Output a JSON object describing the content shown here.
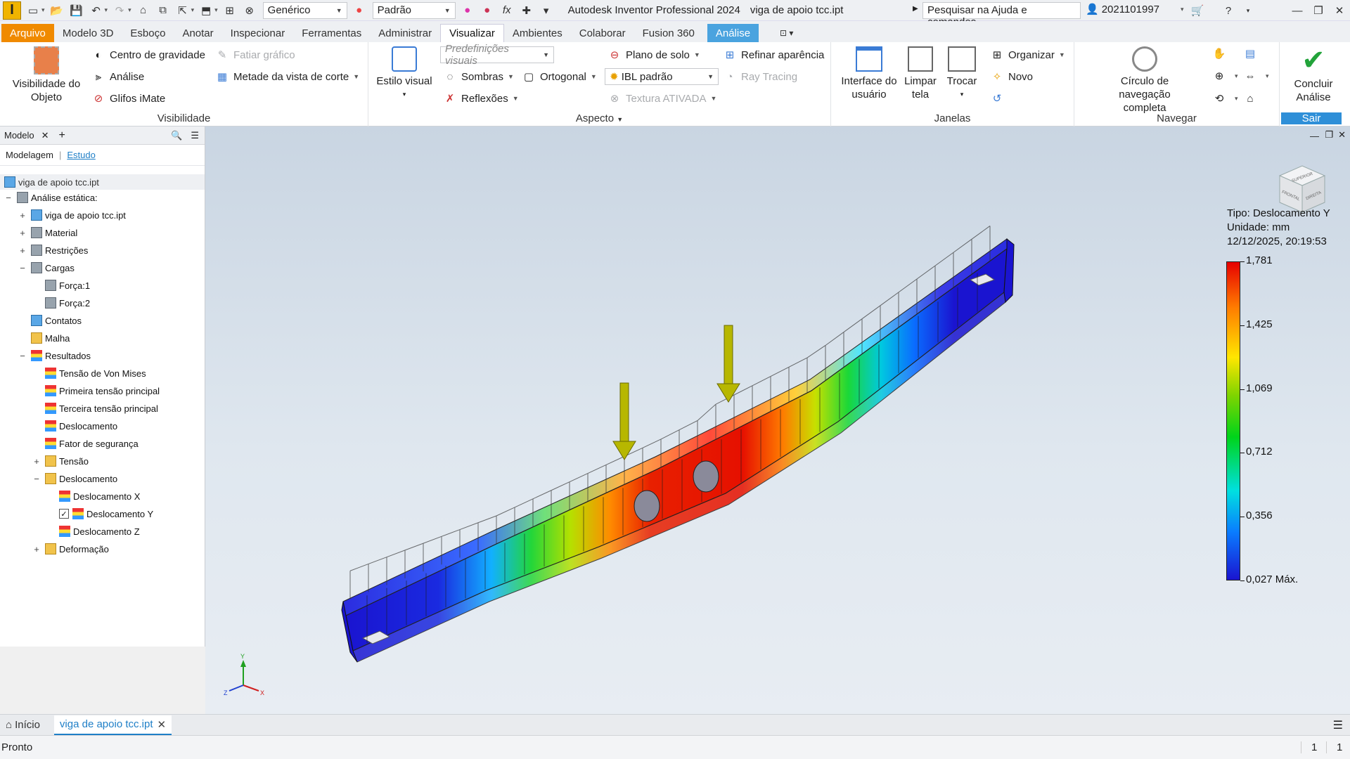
{
  "titlebar": {
    "logo": "I",
    "appearance_combo": "Genérico",
    "material_combo": "Padrão",
    "fx_symbol": "fx",
    "app_title": "Autodesk Inventor Professional 2024",
    "file_title": "viga de apoio tcc.ipt",
    "help_search": "Pesquisar na Ajuda e comandos...",
    "user": "2021101997"
  },
  "tabs": [
    "Arquivo",
    "Modelo 3D",
    "Esboço",
    "Anotar",
    "Inspecionar",
    "Ferramentas",
    "Administrar",
    "Visualizar",
    "Ambientes",
    "Colaborar",
    "Fusion 360",
    "Análise"
  ],
  "ribbon": {
    "visibilidade": {
      "label": "Visibilidade",
      "object_visibility": "Visibilidade do Objeto",
      "center_of_gravity": "Centro de gravidade",
      "analysis": "Análise",
      "imate_glyphs": "Glifos iMate",
      "slice_graphics": "Fatiar gráfico",
      "half_section": "Metade da vista de corte"
    },
    "aspecto": {
      "label": "Aspecto",
      "visual_style": "Estilo visual",
      "visual_presets": "Predefinições visuais",
      "shadows": "Sombras",
      "orthographic": "Ortogonal",
      "reflections": "Reflexões",
      "ground_plane": "Plano de solo",
      "ibl": "IBL padrão",
      "texture": "Textura ATIVADA",
      "refine_appearance": "Refinar aparência",
      "ray_tracing": "Ray Tracing"
    },
    "janelas": {
      "label": "Janelas",
      "user_interface": "Interface do usuário",
      "clean_screen": "Limpar tela",
      "switch": "Trocar",
      "arrange": "Organizar",
      "new": "Novo"
    },
    "navegar": {
      "label": "Navegar",
      "full_nav_wheel": "Círculo de navegação completa"
    },
    "sair": {
      "label": "Sair",
      "finish_analysis": "Concluir Análise"
    }
  },
  "browser": {
    "title": "Modelo",
    "tab_modeling": "Modelagem",
    "tab_study": "Estudo",
    "root": "viga de apoio tcc.ipt",
    "tree": [
      {
        "label": "Análise estática:",
        "level": 0,
        "exp": "−",
        "icon": "gen"
      },
      {
        "label": "viga de apoio tcc.ipt",
        "level": 1,
        "exp": "+",
        "icon": "part"
      },
      {
        "label": "Material",
        "level": 1,
        "exp": "+",
        "icon": "gen"
      },
      {
        "label": "Restrições",
        "level": 1,
        "exp": "+",
        "icon": "gen"
      },
      {
        "label": "Cargas",
        "level": 1,
        "exp": "−",
        "icon": "gen"
      },
      {
        "label": "Força:1",
        "level": 2,
        "exp": "",
        "icon": "gen"
      },
      {
        "label": "Força:2",
        "level": 2,
        "exp": "",
        "icon": "gen"
      },
      {
        "label": "Contatos",
        "level": 1,
        "exp": "",
        "icon": "part"
      },
      {
        "label": "Malha",
        "level": 1,
        "exp": "",
        "icon": "folder"
      },
      {
        "label": "Resultados",
        "level": 1,
        "exp": "−",
        "icon": "res"
      },
      {
        "label": "Tensão de Von Mises",
        "level": 2,
        "exp": "",
        "icon": "res"
      },
      {
        "label": "Primeira tensão principal",
        "level": 2,
        "exp": "",
        "icon": "res"
      },
      {
        "label": "Terceira tensão principal",
        "level": 2,
        "exp": "",
        "icon": "res"
      },
      {
        "label": "Deslocamento",
        "level": 2,
        "exp": "",
        "icon": "res"
      },
      {
        "label": "Fator de segurança",
        "level": 2,
        "exp": "",
        "icon": "res"
      },
      {
        "label": "Tensão",
        "level": 2,
        "exp": "+",
        "icon": "folder"
      },
      {
        "label": "Deslocamento",
        "level": 2,
        "exp": "−",
        "icon": "folder"
      },
      {
        "label": "Deslocamento X",
        "level": 3,
        "exp": "",
        "icon": "res"
      },
      {
        "label": "Deslocamento Y",
        "level": 3,
        "exp": "",
        "icon": "res",
        "checked": true
      },
      {
        "label": "Deslocamento Z",
        "level": 3,
        "exp": "",
        "icon": "res"
      },
      {
        "label": "Deformação",
        "level": 2,
        "exp": "+",
        "icon": "folder"
      }
    ]
  },
  "legend": {
    "type": "Tipo: Deslocamento Y",
    "unit": "Unidade: mm",
    "datetime": "12/12/2025, 20:19:53",
    "values": [
      "1,781",
      "1,425",
      "1,069",
      "0,712",
      "0,356",
      "0,027 Máx."
    ]
  },
  "viewcube": {
    "face_top": "SUPERIOR",
    "face_front": "FRONTAL",
    "face_right": "DIREITA"
  },
  "axes": {
    "x": "X",
    "y": "Y",
    "z": "Z"
  },
  "doc_tabs": {
    "home": "Início",
    "file": "viga de apoio tcc.ipt"
  },
  "status": {
    "text": "Pronto",
    "num1": "1",
    "num2": "1"
  },
  "colors": {
    "file_tab": "#f08a00",
    "analysis_tab": "#4aa3df",
    "accent_blue": "#1f7fc7"
  }
}
